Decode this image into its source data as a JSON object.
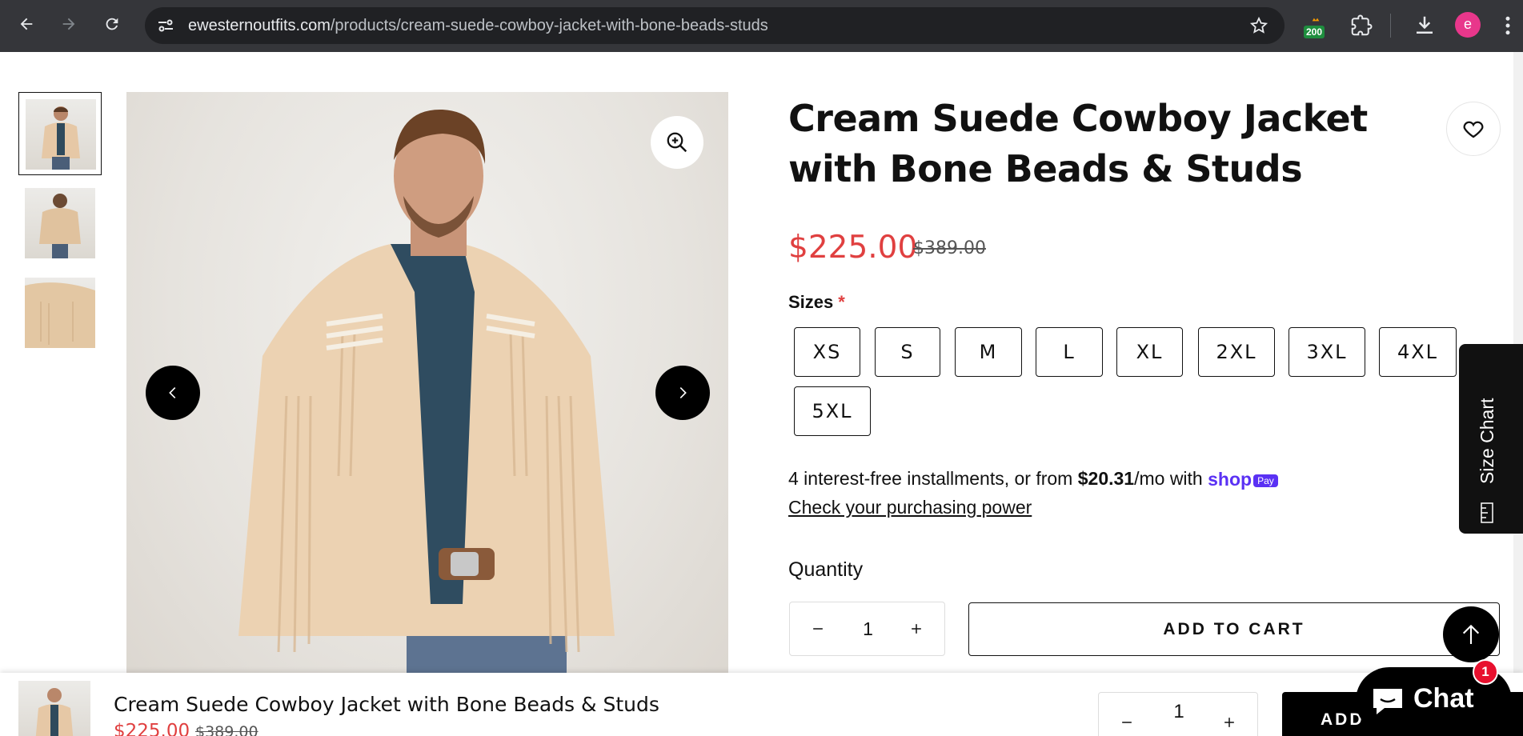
{
  "browser": {
    "url_domain": "ewesternoutfits.com",
    "url_path": "/products/cream-suede-cowboy-jacket-with-bone-beads-studs",
    "extension_badge": "200",
    "profile_initial": "e"
  },
  "product": {
    "title": "Cream Suede Cowboy Jacket with Bone Beads & Studs",
    "price": "$225.00",
    "compare_price": "$389.00",
    "sizes_label": "Sizes",
    "required_mark": "*",
    "sizes": [
      "XS",
      "S",
      "M",
      "L",
      "XL",
      "2XL",
      "3XL",
      "4XL",
      "5XL"
    ],
    "installments_prefix": "4 interest-free installments, or from ",
    "installments_amount": "$20.31",
    "installments_suffix": "/mo with ",
    "shop_pay_text": "shop",
    "shop_pay_badge": "Pay",
    "check_link": "Check your purchasing power",
    "quantity_label": "Quantity",
    "quantity": "1",
    "add_to_cart": "ADD TO CART"
  },
  "size_chart_tab": "Size Chart",
  "sticky_bar": {
    "name": "Cream Suede Cowboy Jacket with Bone Beads & Studs",
    "price": "$225.00",
    "compare_price": "$389.00",
    "quantity": "1",
    "add_label": "ADD TO CART"
  },
  "chat": {
    "label": "Chat",
    "badge": "1"
  },
  "colors": {
    "sale_red": "#e04040",
    "shop_pay_purple": "#5a31f4",
    "chrome_dark": "#35363a"
  }
}
